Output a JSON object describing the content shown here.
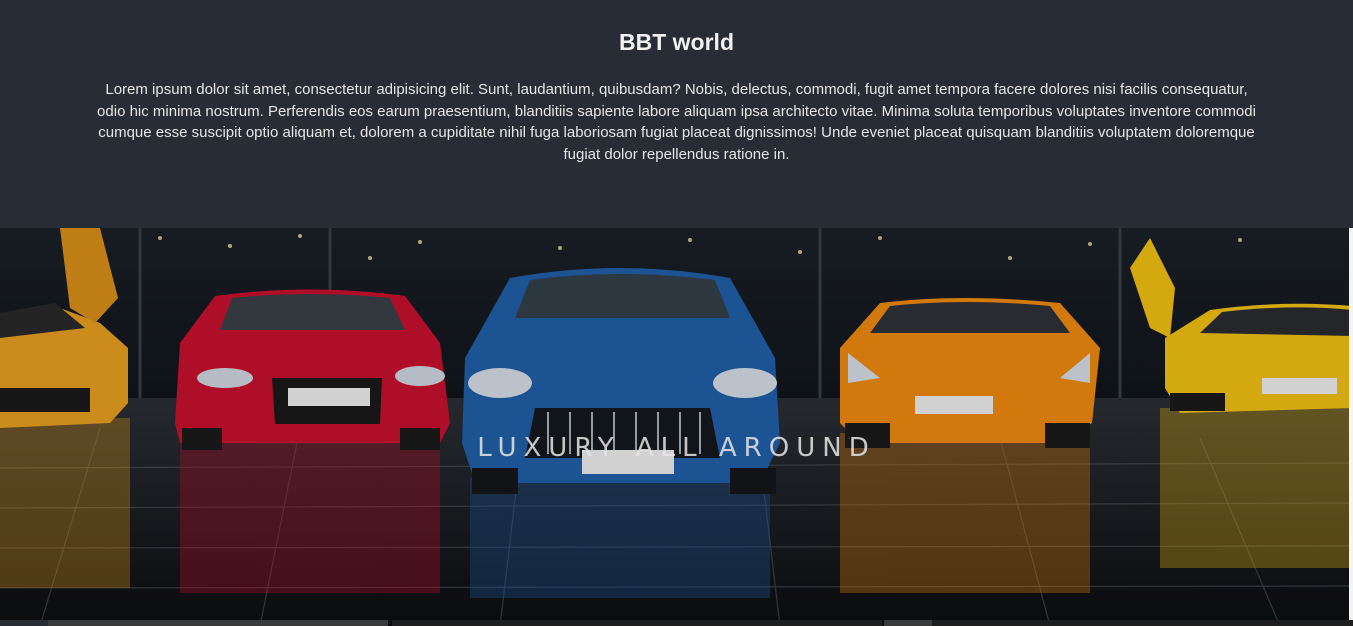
{
  "intro": {
    "title": "BBT world",
    "text": "Lorem ipsum dolor sit amet, consectetur adipisicing elit. Sunt, laudantium, quibusdam? Nobis, delectus, commodi, fugit amet tempora facere dolores nisi facilis consequatur, odio hic minima nostrum. Perferendis eos earum praesentium, blanditiis sapiente labore aliquam ipsa architecto vitae. Minima soluta temporibus voluptates inventore commodi cumque esse suscipit optio aliquam et, dolorem a cupiditate nihil fuga laboriosam fugiat placeat dignissimos! Unde eveniet placeat quisquam blanditiis voluptatem doloremque fugiat dolor repellendus ratione in."
  },
  "hero": {
    "caption": "LUXURY ALL AROUND",
    "image_description_icon": "luxury-cars-photo",
    "car_colors": [
      "#e8a020",
      "#c8102e",
      "#1f5fa8",
      "#f08a10",
      "#f2c012"
    ]
  },
  "colors": {
    "background": "#282c34",
    "text": "#e6e6e6"
  }
}
